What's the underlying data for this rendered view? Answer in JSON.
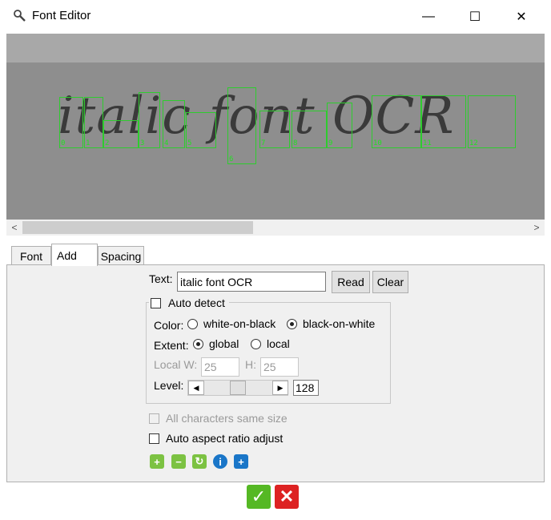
{
  "window": {
    "title": "Font Editor",
    "icon": "magnifier-icon",
    "minimize_glyph": "—",
    "maximize_glyph": "☐",
    "close_glyph": "✕"
  },
  "preview": {
    "sample_text": "italic font OCR",
    "glyph_labels": [
      "0",
      "1",
      "2",
      "3",
      "4",
      "5",
      "6",
      "7",
      "8",
      "9",
      "10",
      "11",
      "12"
    ],
    "box_color": "#2ecc2e",
    "left_arrow": "<",
    "right_arrow": ">"
  },
  "tabs": [
    {
      "label": "Font",
      "active": false
    },
    {
      "label": "Add",
      "active": true
    },
    {
      "label": "Spacing",
      "active": false
    }
  ],
  "add_tab": {
    "text_label": "Text:",
    "text_value": "italic font OCR",
    "read_button": "Read",
    "clear_button": "Clear",
    "auto_detect_label": "Auto detect",
    "color_label": "Color:",
    "color_options": [
      "white-on-black",
      "black-on-white"
    ],
    "color_selected": "black-on-white",
    "extent_label": "Extent:",
    "extent_options": [
      "global",
      "local"
    ],
    "extent_selected": "global",
    "local_w_label": "Local W:",
    "local_w_value": "25",
    "h_label": "H:",
    "h_value": "25",
    "level_label": "Level:",
    "level_value": "128",
    "level_fraction": 0.5,
    "same_size_label": "All characters same size",
    "aspect_label": "Auto aspect ratio adjust"
  },
  "toolbar_icons": [
    {
      "name": "zoom-in-icon",
      "glyph": "+",
      "color": "#7cc242"
    },
    {
      "name": "zoom-out-icon",
      "glyph": "−",
      "color": "#7cc242"
    },
    {
      "name": "refresh-icon",
      "glyph": "↻",
      "color": "#7cc242"
    },
    {
      "name": "info-icon",
      "glyph": "i",
      "color": "#1a76c8"
    },
    {
      "name": "add-icon",
      "glyph": "+",
      "color": "#1a76c8"
    }
  ],
  "dialog_buttons": {
    "ok_glyph": "✓",
    "cancel_glyph": "✕"
  }
}
